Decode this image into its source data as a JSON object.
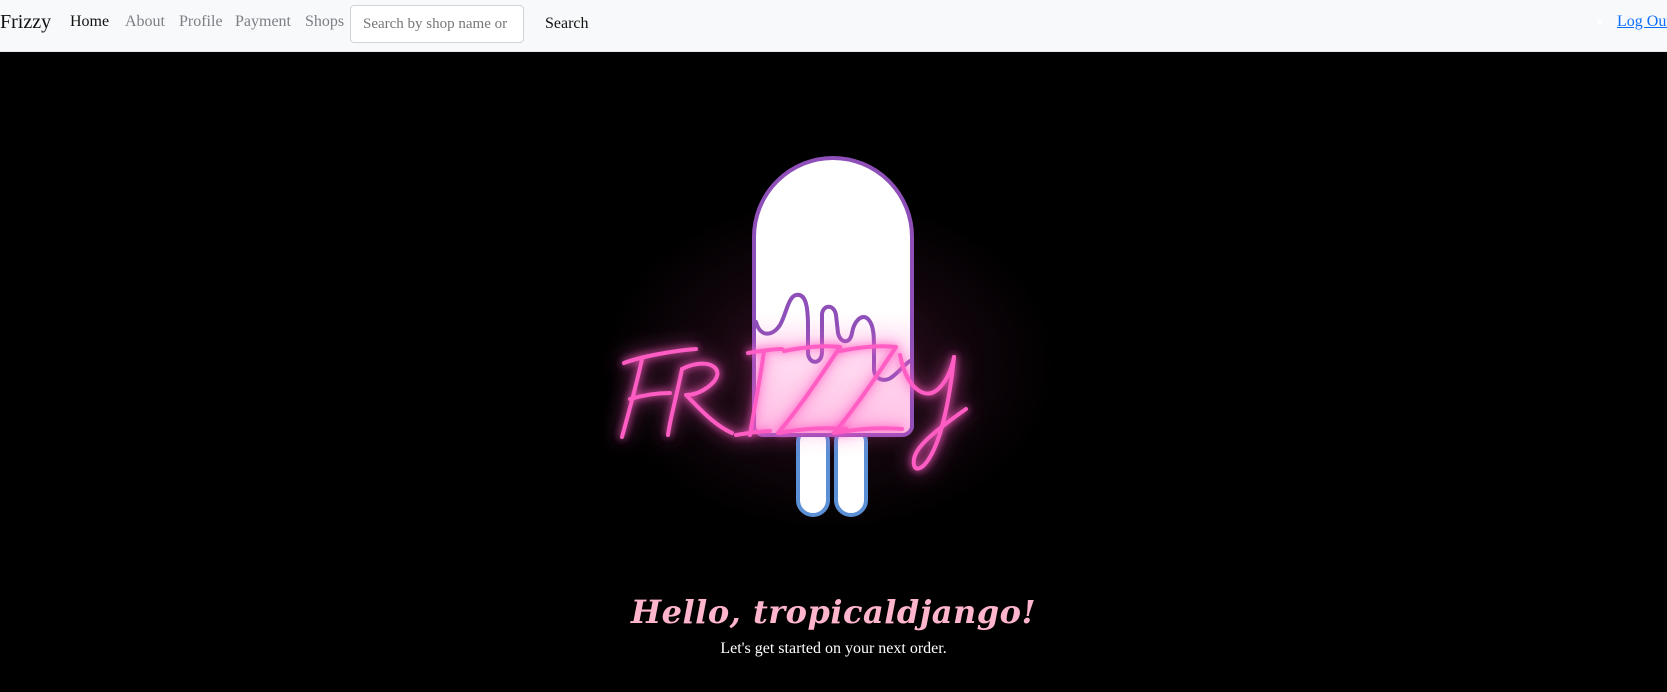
{
  "navbar": {
    "brand": "Frizzy",
    "links": [
      {
        "label": "Home",
        "active": true
      },
      {
        "label": "About",
        "active": false
      },
      {
        "label": "Profile",
        "active": false
      },
      {
        "label": "Payment",
        "active": false
      },
      {
        "label": "Shops",
        "active": false
      }
    ],
    "search": {
      "placeholder": "Search by shop name or location",
      "value": "",
      "button_label": "Search"
    },
    "logout_label": "Log Out"
  },
  "hero": {
    "logo_text": "FRIZZY",
    "greeting": "Hello, tropicaldjango!",
    "subtitle": "Let's get started on your next order."
  },
  "colors": {
    "navbar_bg": "#f8f9fa",
    "page_bg": "#000000",
    "neon_pink": "#ff5cc4",
    "greeting_pink": "#ffb6cc",
    "popsicle_outline_purple": "#8e4fb8",
    "popsicle_stick_blue": "#5b8fd6",
    "link_blue": "#0d6efd"
  }
}
